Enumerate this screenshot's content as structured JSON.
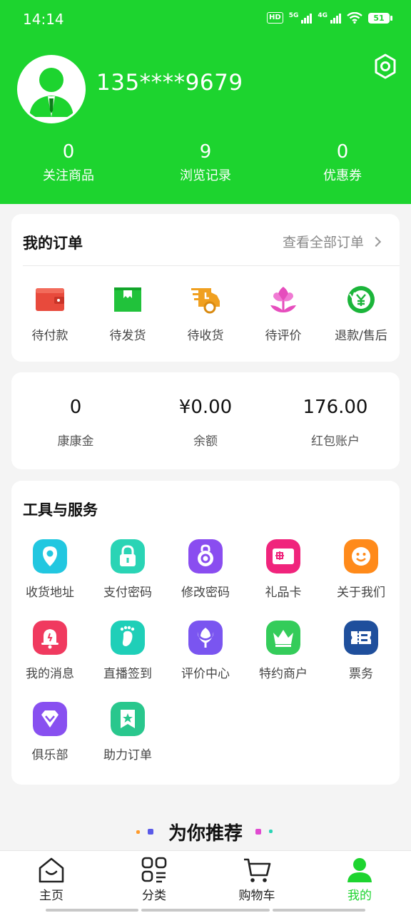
{
  "status": {
    "time": "14:14",
    "hd": "HD",
    "net1": "5G",
    "net2": "4G",
    "battery": "51"
  },
  "profile": {
    "phone": "135****9679",
    "settings_icon": "settings-hexagon-icon"
  },
  "stats": [
    {
      "value": "0",
      "label": "关注商品"
    },
    {
      "value": "9",
      "label": "浏览记录"
    },
    {
      "value": "0",
      "label": "优惠券"
    }
  ],
  "orders": {
    "title": "我的订单",
    "view_all": "查看全部订单",
    "items": [
      {
        "label": "待付款",
        "icon": "wallet-icon"
      },
      {
        "label": "待发货",
        "icon": "box-icon"
      },
      {
        "label": "待收货",
        "icon": "delivery-truck-icon"
      },
      {
        "label": "待评价",
        "icon": "flower-icon"
      },
      {
        "label": "退款/售后",
        "icon": "refund-icon"
      }
    ]
  },
  "wallet": [
    {
      "value": "0",
      "label": "康康金"
    },
    {
      "value": "¥0.00",
      "label": "余额"
    },
    {
      "value": "176.00",
      "label": "红包账户"
    }
  ],
  "tools": {
    "title": "工具与服务",
    "items": [
      {
        "label": "收货地址",
        "icon": "location-icon",
        "color": "#22c7e0"
      },
      {
        "label": "支付密码",
        "icon": "lock-icon",
        "color": "#2ad4b5"
      },
      {
        "label": "修改密码",
        "icon": "key-lock-icon",
        "color": "#8a4df0"
      },
      {
        "label": "礼品卡",
        "icon": "gift-card-icon",
        "color": "#f0247c"
      },
      {
        "label": "关于我们",
        "icon": "smile-icon",
        "color": "#ff8a1a"
      },
      {
        "label": "我的消息",
        "icon": "bell-icon",
        "color": "#f03a5f"
      },
      {
        "label": "直播签到",
        "icon": "footprint-icon",
        "color": "#1fcfb8"
      },
      {
        "label": "评价中心",
        "icon": "flower-icon",
        "color": "#7a55f0"
      },
      {
        "label": "特约商户",
        "icon": "crown-icon",
        "color": "#34cc5a"
      },
      {
        "label": "票务",
        "icon": "ticket-icon",
        "color": "#1f4f9c"
      },
      {
        "label": "俱乐部",
        "icon": "diamond-icon",
        "color": "#8850f0"
      },
      {
        "label": "助力订单",
        "icon": "bookmark-star-icon",
        "color": "#29c78d"
      }
    ]
  },
  "recommend": {
    "title": "为你推荐"
  },
  "tabbar": [
    {
      "label": "主页",
      "icon": "home-icon",
      "active": false
    },
    {
      "label": "分类",
      "icon": "category-icon",
      "active": false
    },
    {
      "label": "购物车",
      "icon": "cart-icon",
      "active": false
    },
    {
      "label": "我的",
      "icon": "user-icon",
      "active": true
    }
  ],
  "colors": {
    "brand": "#1dd42f",
    "background": "#f4f4f4"
  }
}
